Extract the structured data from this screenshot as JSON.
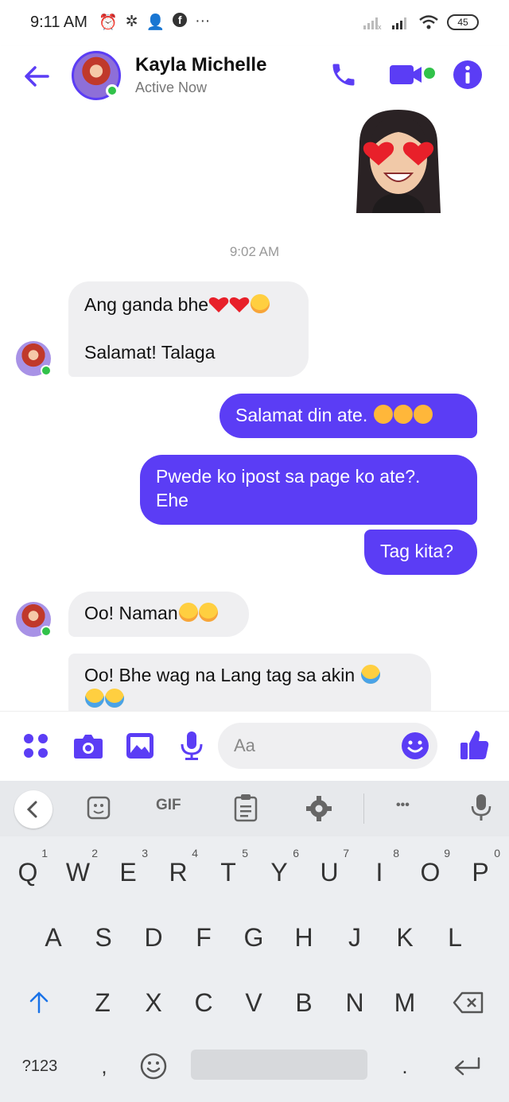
{
  "status_bar": {
    "time": "9:11 AM",
    "left_icons": [
      "alarm-icon",
      "pinwheel-icon",
      "add-contact-icon",
      "facebook-icon",
      "more-icon"
    ],
    "battery": "45"
  },
  "header": {
    "contact_name": "Kayla Michelle",
    "contact_status": "Active Now",
    "accent_color": "#5b3df5"
  },
  "conversation": {
    "timestamp": "9:02 AM",
    "messages": [
      {
        "direction": "in",
        "line1": "Ang ganda bhe",
        "line2": "Salamat! Talaga"
      },
      {
        "direction": "out",
        "text": "Salamat din ate. "
      },
      {
        "direction": "out",
        "line1": "Pwede ko ipost sa page ko ate?.",
        "line2": "Ehe"
      },
      {
        "direction": "out",
        "text": "Tag kita?"
      },
      {
        "direction": "in",
        "text": "Oo! Naman"
      },
      {
        "direction": "in",
        "line1": "Oo! Bhe wag na Lang tag sa akin "
      }
    ]
  },
  "composer": {
    "placeholder": "Aa"
  },
  "keyboard": {
    "toolbar_gif": "GIF",
    "toolbar_more": "•••",
    "row1": [
      {
        "key": "Q",
        "hint": "1"
      },
      {
        "key": "W",
        "hint": "2"
      },
      {
        "key": "E",
        "hint": "3"
      },
      {
        "key": "R",
        "hint": "4"
      },
      {
        "key": "T",
        "hint": "5"
      },
      {
        "key": "Y",
        "hint": "6"
      },
      {
        "key": "U",
        "hint": "7"
      },
      {
        "key": "I",
        "hint": "8"
      },
      {
        "key": "O",
        "hint": "9"
      },
      {
        "key": "P",
        "hint": "0"
      }
    ],
    "row2": [
      "A",
      "S",
      "D",
      "F",
      "G",
      "H",
      "J",
      "K",
      "L"
    ],
    "row3": [
      "Z",
      "X",
      "C",
      "V",
      "B",
      "N",
      "M"
    ],
    "symbols_key": "?123",
    "comma": ",",
    "period": "."
  }
}
